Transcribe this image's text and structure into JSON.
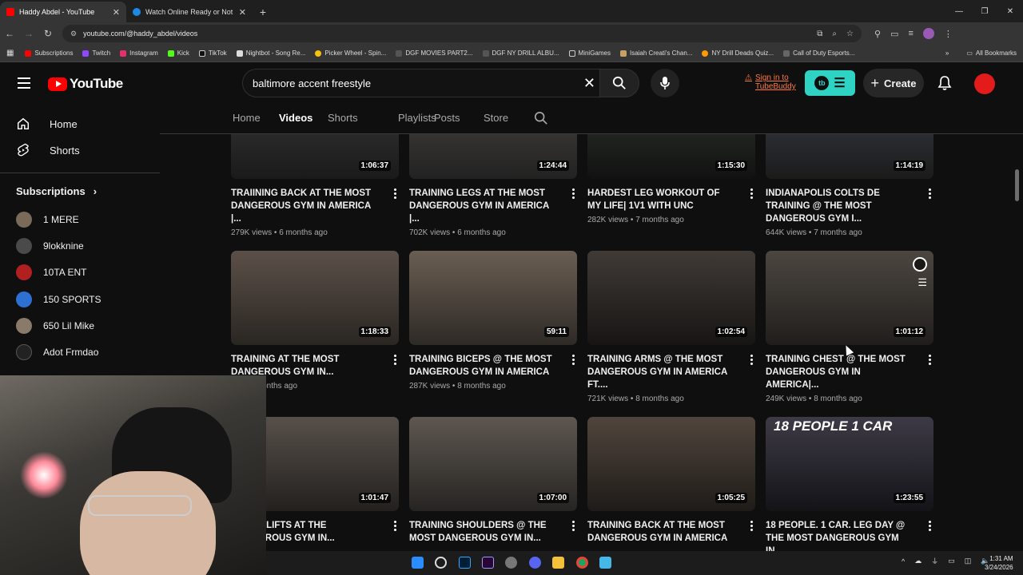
{
  "browser": {
    "tabs": [
      {
        "title": "Haddy Abdel - YouTube",
        "active": true,
        "favicon_color": "#ff0000"
      },
      {
        "title": "Watch Online Ready or Not 2: H",
        "active": false,
        "favicon_color": "#1e88e5"
      }
    ],
    "url": "youtube.com/@haddy_abdel/videos",
    "bookmarks": [
      "Subscriptions",
      "Twitch",
      "Instagram",
      "Kick",
      "TikTok",
      "Nightbot - Song Re...",
      "Picker Wheel - Spin...",
      "DGF MOVIES PART2...",
      "DGF NY DRILL ALBU...",
      "MiniGames",
      "Isaiah Creati's Chan...",
      "NY Drill Deads Quiz...",
      "Call of Duty Esports..."
    ],
    "all_bookmarks": "All Bookmarks"
  },
  "youtube": {
    "logo_text": "YouTube",
    "search_value": "baltimore accent freestyle",
    "tubebuddy_line1": "Sign in to",
    "tubebuddy_line2": "TubeBuddy",
    "create_label": "Create",
    "accent": "#ff0000"
  },
  "sidebar": {
    "items": [
      {
        "label": "Home",
        "icon": "home-icon"
      },
      {
        "label": "Shorts",
        "icon": "shorts-icon"
      }
    ],
    "subscriptions_heading": "Subscriptions",
    "subscriptions": [
      {
        "name": "1 MERE",
        "color": "#7a6a5a"
      },
      {
        "name": "9lokknine",
        "color": "#4a4a4a"
      },
      {
        "name": "10TA ENT",
        "color": "#b02020"
      },
      {
        "name": "150 SPORTS",
        "color": "#2d6fd3"
      },
      {
        "name": "650 Lil Mike",
        "color": "#8a7a6a"
      },
      {
        "name": "Adot Frmdao",
        "color": "#222222"
      }
    ]
  },
  "channel_nav": {
    "tabs": [
      "Home",
      "Videos",
      "Shorts",
      "Playlists",
      "Posts",
      "Store"
    ],
    "active": "Videos"
  },
  "videos": [
    {
      "title": "TRAIINING BACK AT THE MOST DANGEROUS GYM IN AMERICA |...",
      "views": "279K views",
      "age": "6 months ago",
      "duration": "1:06:37"
    },
    {
      "title": "TRAINING LEGS AT THE MOST DANGEROUS GYM IN AMERICA |...",
      "views": "702K views",
      "age": "6 months ago",
      "duration": "1:24:44"
    },
    {
      "title": "HARDEST LEG WORKOUT OF MY LIFE| 1v1 WITH UNC",
      "views": "282K views",
      "age": "7 months ago",
      "duration": "1:15:30"
    },
    {
      "title": "INDIANAPOLIS COLTS DE TRAINING @ THE MOST DANGEROUS GYM I...",
      "views": "644K views",
      "age": "7 months ago",
      "duration": "1:14:19"
    },
    {
      "title": "TRAINING AT THE MOST DANGEROUS GYM IN...",
      "views": "...s",
      "age": "7 months ago",
      "duration": "1:18:33"
    },
    {
      "title": "TRAINING BICEPS @ THE MOST DANGEROUS GYM IN AMERICA",
      "views": "287K views",
      "age": "8 months ago",
      "duration": "59:11"
    },
    {
      "title": "TRAINING ARMS @ THE MOST DANGEROUS GYM IN AMERICA ft....",
      "views": "721K views",
      "age": "8 months ago",
      "duration": "1:02:54"
    },
    {
      "title": "TRAINING CHEST @ THE MOST DANGEROUS GYM IN AMERICA|...",
      "views": "249K views",
      "age": "8 months ago",
      "duration": "1:01:12"
    },
    {
      "title": "& DEADLIFTS AT THE ...ANGEROUS GYM IN...",
      "views": "",
      "age": "",
      "duration": "1:01:47"
    },
    {
      "title": "TRAINING SHOULDERS @ THE MOST DANGEROUS GYM IN...",
      "views": "",
      "age": "",
      "duration": "1:07:00"
    },
    {
      "title": "TRAINING BACK AT THE MOST DANGEROUS GYM IN AMERICA",
      "views": "",
      "age": "",
      "duration": "1:05:25"
    },
    {
      "title": "18 PEOPLE. 1 CAR. LEG DAY @ THE MOST DANGEROUS GYM IN...",
      "views": "",
      "age": "",
      "duration": "1:23:55",
      "thumb_text": "18 PEOPLE 1 CAR"
    }
  ],
  "taskbar": {
    "time": "1:31 AM",
    "date": "3/24/2026"
  }
}
